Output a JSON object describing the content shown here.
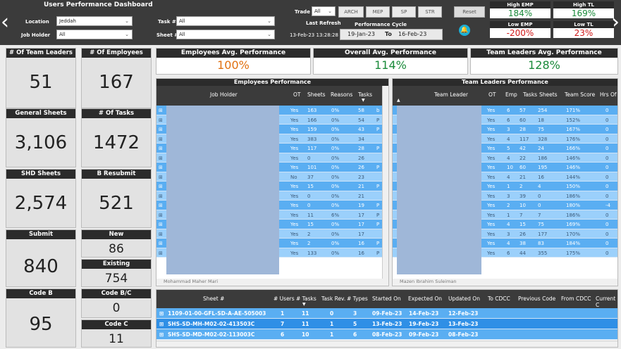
{
  "header": {
    "title": "Users Performance Dashboard",
    "location_label": "Location",
    "location_value": "Jeddah",
    "job_holder_label": "Job Holder",
    "job_holder_value": "All",
    "task_label": "Task #",
    "task_value": "All",
    "sheet_label": "Sheet #",
    "sheet_value": "All",
    "trade_label": "Trade",
    "trade_value": "All",
    "last_refresh_label": "Last Refresh",
    "last_refresh_value": "13-Feb-23 13:28:28",
    "trade_buttons": [
      "ARCH",
      "MEP",
      "SP",
      "STR"
    ],
    "reset_label": "Reset",
    "cycle_title": "Performance Cycle",
    "cycle_from": "19-Jan-23",
    "cycle_to_label": "To",
    "cycle_to": "16-Feb-23",
    "prev_icon": "chevron-left",
    "next_icon": "chevron-right",
    "bell_icon": "bell"
  },
  "kpis": [
    {
      "label": "High EMP",
      "value": "184%",
      "color": "#1a8a3a"
    },
    {
      "label": "High TL",
      "value": "169%",
      "color": "#1a8a3a"
    },
    {
      "label": "Low EMP",
      "value": "-200%",
      "color": "#d01818"
    },
    {
      "label": "Low TL",
      "value": "23%",
      "color": "#d01818"
    }
  ],
  "cards": {
    "team_leaders": {
      "label": "# Of Team Leaders",
      "value": "51"
    },
    "employees": {
      "label": "# Of Employees",
      "value": "167"
    },
    "general_sheets": {
      "label": "General Sheets",
      "value": "3,106"
    },
    "tasks": {
      "label": "# Of Tasks",
      "value": "1472"
    },
    "shd_sheets": {
      "label": "SHD Sheets",
      "value": "2,574"
    },
    "b_resubmit": {
      "label": "B Resubmit",
      "value": "521"
    },
    "submit": {
      "label": "Submit",
      "value": "840"
    },
    "new": {
      "label": "New",
      "value": "86"
    },
    "existing": {
      "label": "Existing",
      "value": "754"
    },
    "code_b": {
      "label": "Code B",
      "value": "95"
    },
    "code_bc": {
      "label": "Code B/C",
      "value": "0"
    },
    "code_c": {
      "label": "Code C",
      "value": "11"
    }
  },
  "averages": [
    {
      "label": "Employees Avg. Performance",
      "value": "100%",
      "color": "#e07010"
    },
    {
      "label": "Overall Avg. Performance",
      "value": "114%",
      "color": "#1a8a3a"
    },
    {
      "label": "Team Leaders Avg. Performance",
      "value": "128%",
      "color": "#1a8a3a"
    }
  ],
  "emp_table": {
    "title": "Employees Performance",
    "columns": [
      "Job Holder",
      "OT",
      "Sheets",
      "Reasons",
      "Tasks"
    ],
    "rows": [
      [
        "Yes",
        "163",
        "0%",
        "58"
      ],
      [
        "Yes",
        "166",
        "0%",
        "54"
      ],
      [
        "Yes",
        "159",
        "0%",
        "43"
      ],
      [
        "Yes",
        "383",
        "0%",
        "34"
      ],
      [
        "Yes",
        "117",
        "0%",
        "28"
      ],
      [
        "Yes",
        "0",
        "0%",
        "26"
      ],
      [
        "Yes",
        "101",
        "0%",
        "26"
      ],
      [
        "No",
        "37",
        "0%",
        "23"
      ],
      [
        "Yes",
        "15",
        "0%",
        "21"
      ],
      [
        "Yes",
        "0",
        "0%",
        "21"
      ],
      [
        "Yes",
        "0",
        "0%",
        "19"
      ],
      [
        "Yes",
        "11",
        "6%",
        "17"
      ],
      [
        "Yes",
        "15",
        "0%",
        "17"
      ],
      [
        "Yes",
        "2",
        "0%",
        "17"
      ],
      [
        "Yes",
        "2",
        "0%",
        "16"
      ],
      [
        "Yes",
        "133",
        "0%",
        "16"
      ]
    ],
    "side_marks": [
      "b",
      "P",
      "P",
      "",
      "P",
      "",
      "P",
      "",
      "P",
      "",
      "P",
      "P",
      "P",
      "",
      "P",
      "P"
    ],
    "footer_text": "Mohammad Maher Mari"
  },
  "tl_table": {
    "title": "Team Leaders Performance",
    "columns": [
      "Team Leader",
      "OT",
      "Emp",
      "Tasks",
      "Sheets",
      "Team Score",
      "Hrs Of"
    ],
    "rows": [
      [
        "Yes",
        "6",
        "57",
        "254",
        "171%",
        "0"
      ],
      [
        "Yes",
        "6",
        "60",
        "18",
        "152%",
        "0"
      ],
      [
        "Yes",
        "3",
        "28",
        "75",
        "167%",
        "0"
      ],
      [
        "Yes",
        "4",
        "117",
        "328",
        "176%",
        "0"
      ],
      [
        "Yes",
        "5",
        "42",
        "24",
        "166%",
        "0"
      ],
      [
        "Yes",
        "4",
        "22",
        "186",
        "146%",
        "0"
      ],
      [
        "Yes",
        "10",
        "60",
        "195",
        "146%",
        "0"
      ],
      [
        "Yes",
        "4",
        "21",
        "16",
        "144%",
        "0"
      ],
      [
        "Yes",
        "1",
        "2",
        "4",
        "150%",
        "0"
      ],
      [
        "Yes",
        "3",
        "39",
        "0",
        "186%",
        "0"
      ],
      [
        "Yes",
        "2",
        "10",
        "0",
        "180%",
        "-4"
      ],
      [
        "Yes",
        "1",
        "7",
        "7",
        "186%",
        "0"
      ],
      [
        "Yes",
        "4",
        "15",
        "75",
        "169%",
        "0"
      ],
      [
        "Yes",
        "3",
        "26",
        "177",
        "170%",
        "0"
      ],
      [
        "Yes",
        "4",
        "38",
        "83",
        "184%",
        "0"
      ],
      [
        "Yes",
        "6",
        "44",
        "355",
        "175%",
        "0"
      ]
    ],
    "footer_text": "Mazen Ibrahim Suleiman"
  },
  "sheet_table": {
    "columns": [
      "Sheet #",
      "# Users",
      "# Tasks",
      "Task Rev.",
      "# Types",
      "Started On",
      "Expected On",
      "Updated On",
      "To CDCC",
      "Previous Code",
      "From CDCC",
      "Current C"
    ],
    "rows": [
      [
        "1109-01-00-GFL-SD-A-AE-505003",
        "1",
        "11",
        "0",
        "3",
        "09-Feb-23",
        "14-Feb-23",
        "12-Feb-23"
      ],
      [
        "SHS-SD-MH-M02-02-413503C",
        "7",
        "11",
        "1",
        "5",
        "13-Feb-23",
        "19-Feb-23",
        "13-Feb-23"
      ],
      [
        "SHS-SD-MD-M02-02-113003C",
        "6",
        "10",
        "1",
        "6",
        "08-Feb-23",
        "09-Feb-23",
        "08-Feb-23"
      ]
    ]
  }
}
